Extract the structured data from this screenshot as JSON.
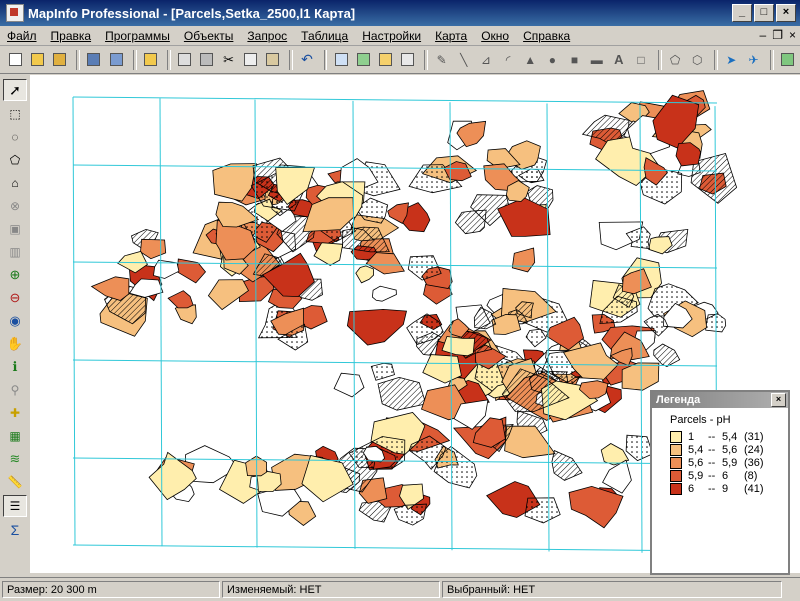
{
  "window": {
    "title": "MapInfo Professional - [Parcels,Setka_2500,l1 Карта]"
  },
  "menu": [
    "Файл",
    "Правка",
    "Программы",
    "Объекты",
    "Запрос",
    "Таблица",
    "Настройки",
    "Карта",
    "Окно",
    "Справка"
  ],
  "legend": {
    "window_title": "Легенда",
    "layer_title": "Parcels - pH",
    "items": [
      {
        "range_from": "1",
        "range_to": "5,4",
        "count": "(31)",
        "color": "#ffeead"
      },
      {
        "range_from": "5,4",
        "range_to": "5,6",
        "count": "(24)",
        "color": "#f6c07f"
      },
      {
        "range_from": "5,6",
        "range_to": "5,9",
        "count": "(36)",
        "color": "#ed8f57"
      },
      {
        "range_from": "5,9",
        "range_to": "6",
        "count": "(8)",
        "color": "#dd5b36"
      },
      {
        "range_from": "6",
        "range_to": "9",
        "count": "(41)",
        "color": "#c8321a"
      }
    ]
  },
  "status": {
    "size": "Размер: 20 300 m",
    "editable": "Изменяемый: НЕТ",
    "selected": "Выбранный: НЕТ"
  },
  "colors": {
    "grid": "#30c8d8",
    "titlebar": "#0a246a"
  }
}
